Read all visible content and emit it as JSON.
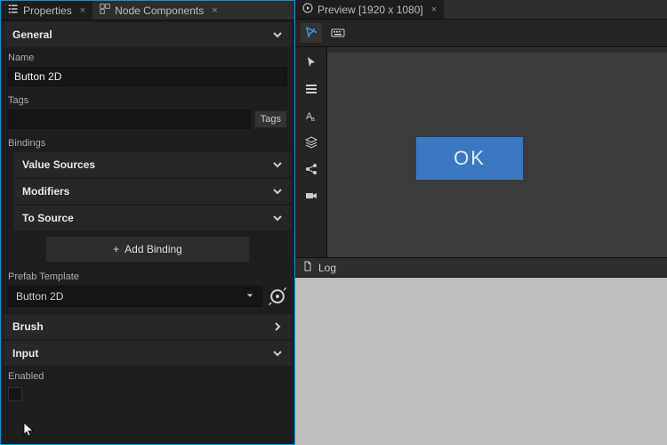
{
  "left": {
    "tabs": {
      "properties": "Properties",
      "nodeComponents": "Node Components"
    },
    "general": "General",
    "nameLabel": "Name",
    "nameValue": "Button 2D",
    "tagsLabel": "Tags",
    "tagsValue": "",
    "tagsBtn": "Tags",
    "bindingsLabel": "Bindings",
    "valueSources": "Value Sources",
    "modifiers": "Modifiers",
    "toSource": "To Source",
    "addBinding": "Add Binding",
    "prefabLabel": "Prefab Template",
    "prefabValue": "Button 2D",
    "brush": "Brush",
    "input": "Input",
    "enabledLabel": "Enabled"
  },
  "right": {
    "previewTab": "Preview [1920 x 1080]",
    "okLabel": "OK",
    "logLabel": "Log"
  }
}
